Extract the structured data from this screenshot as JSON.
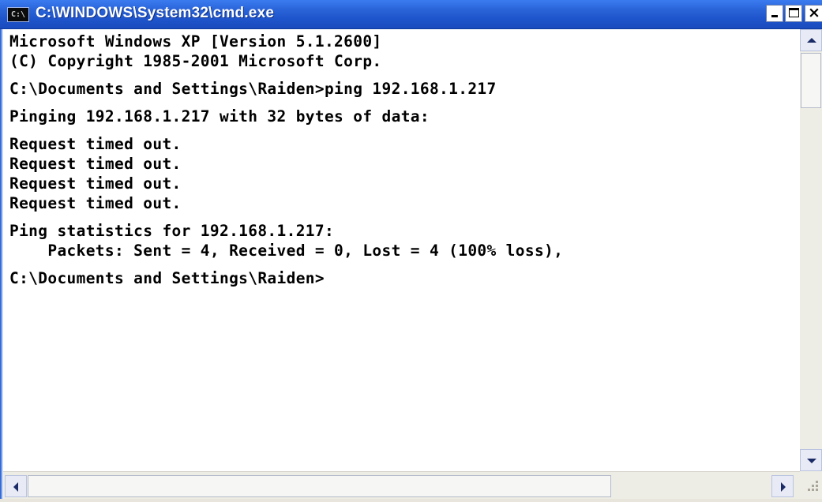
{
  "window": {
    "title": "C:\\WINDOWS\\System32\\cmd.exe",
    "icon_text": "C:\\",
    "controls": {
      "minimize": "minimize",
      "maximize": "maximize",
      "close": "×"
    }
  },
  "console": {
    "lines": [
      "Microsoft Windows XP [Version 5.1.2600]",
      "(C) Copyright 1985-2001 Microsoft Corp.",
      "",
      "C:\\Documents and Settings\\Raiden>ping 192.168.1.217",
      "",
      "Pinging 192.168.1.217 with 32 bytes of data:",
      "",
      "Request timed out.",
      "Request timed out.",
      "Request timed out.",
      "Request timed out.",
      "",
      "Ping statistics for 192.168.1.217:",
      "    Packets: Sent = 4, Received = 0, Lost = 4 (100% loss),",
      "",
      "C:\\Documents and Settings\\Raiden>"
    ]
  },
  "colors": {
    "titlebar": "#2a63d8",
    "console_background": "#ffffff",
    "console_text": "#000000"
  }
}
